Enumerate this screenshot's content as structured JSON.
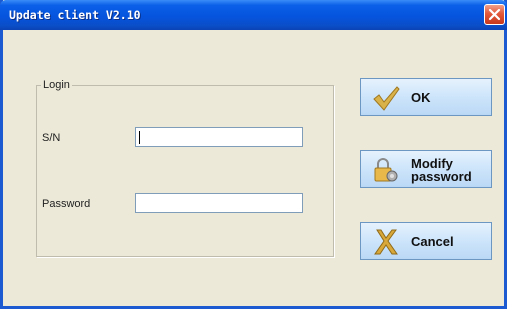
{
  "window": {
    "title": "Update client V2.10"
  },
  "group": {
    "legend": "Login"
  },
  "fields": {
    "sn_label": "S/N",
    "sn_value": "",
    "password_label": "Password",
    "password_value": ""
  },
  "buttons": {
    "ok_label": "OK",
    "modify_line1": "Modify",
    "modify_line2": "password",
    "cancel_label": "Cancel"
  },
  "icons": {
    "close": "close-icon",
    "ok": "checkmark-icon",
    "modify": "lock-gear-icon",
    "cancel": "x-icon"
  },
  "colors": {
    "titlebar": "#0654de",
    "close_button": "#e2593a",
    "window_bg": "#ece9d8",
    "button_bg": "#cfe6fb"
  }
}
